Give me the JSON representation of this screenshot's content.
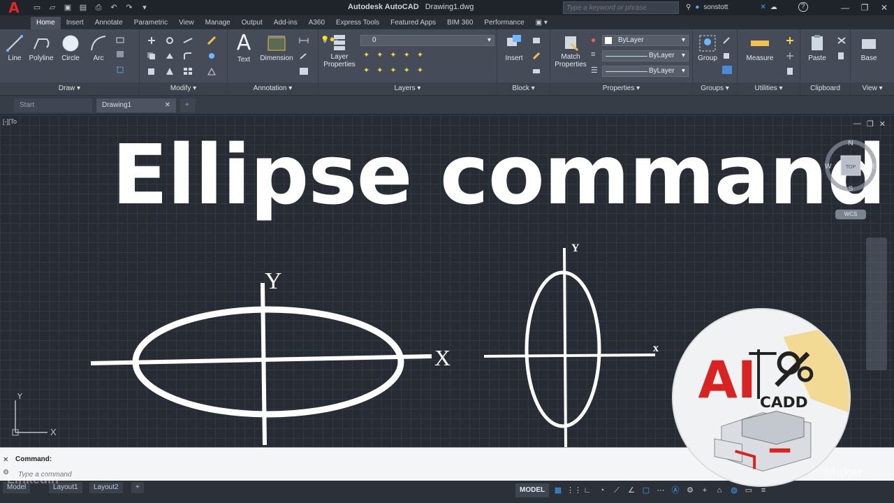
{
  "titlebar": {
    "app_name": "Autodesk AutoCAD",
    "document": "Drawing1.dwg",
    "search_placeholder": "Type a keyword or phrase",
    "username": "sonstott",
    "help": "?"
  },
  "ribbon_tabs": [
    "Home",
    "Insert",
    "Annotate",
    "Parametric",
    "View",
    "Manage",
    "Output",
    "Add-ins",
    "A360",
    "Express Tools",
    "Featured Apps",
    "BIM 360",
    "Performance"
  ],
  "ribbon": {
    "draw": {
      "title": "Draw",
      "tools": [
        "Line",
        "Polyline",
        "Circle",
        "Arc"
      ]
    },
    "modify": {
      "title": "Modify"
    },
    "annotation": {
      "title": "Annotation",
      "tools": [
        "Text",
        "Dimension"
      ]
    },
    "layers": {
      "title": "Layers",
      "tool_line1": "Layer",
      "tool_line2": "Properties",
      "layer_value": "0"
    },
    "block": {
      "title": "Block",
      "tools": [
        "Insert"
      ]
    },
    "properties": {
      "title": "Properties",
      "tool_line1": "Match",
      "tool_line2": "Properties",
      "color": "ByLayer",
      "linetype": "ByLayer",
      "lineweight": "ByLayer"
    },
    "groups": {
      "title": "Groups",
      "tools": [
        "Group"
      ]
    },
    "utilities": {
      "title": "Utilities",
      "tools": [
        "Measure"
      ]
    },
    "clipboard": {
      "title": "Clipboard",
      "tools": [
        "Paste"
      ]
    },
    "view": {
      "title": "View",
      "tools": [
        "Base"
      ]
    }
  },
  "file_tabs": {
    "start": "Start",
    "drawing": "Drawing1"
  },
  "viewport": {
    "label": "[-][To",
    "headline": "Ellipse command",
    "ellipse1": {
      "y_label": "Y",
      "x_label": "X"
    },
    "ellipse2": {
      "y_label": "Y",
      "x_label": "x"
    },
    "ucs": {
      "y": "Y",
      "x": "X"
    }
  },
  "viewcube": {
    "n": "N",
    "s": "S",
    "e": "E",
    "w": "W",
    "face": "TOP",
    "wcs": "WCS"
  },
  "brand": {
    "text1": "AI",
    "text2": "CADD"
  },
  "commandline": {
    "history": "Command:",
    "placeholder": "Type a command"
  },
  "layout_tabs": [
    "Model",
    "Layout1",
    "Layout2"
  ],
  "status": {
    "model": "MODEL"
  },
  "watermarks": {
    "left": "Linkedin",
    "right": "Maker"
  },
  "colors": {
    "accent": "#3ea2ff",
    "autocad_red": "#e02626",
    "canvas": "#262b34"
  }
}
